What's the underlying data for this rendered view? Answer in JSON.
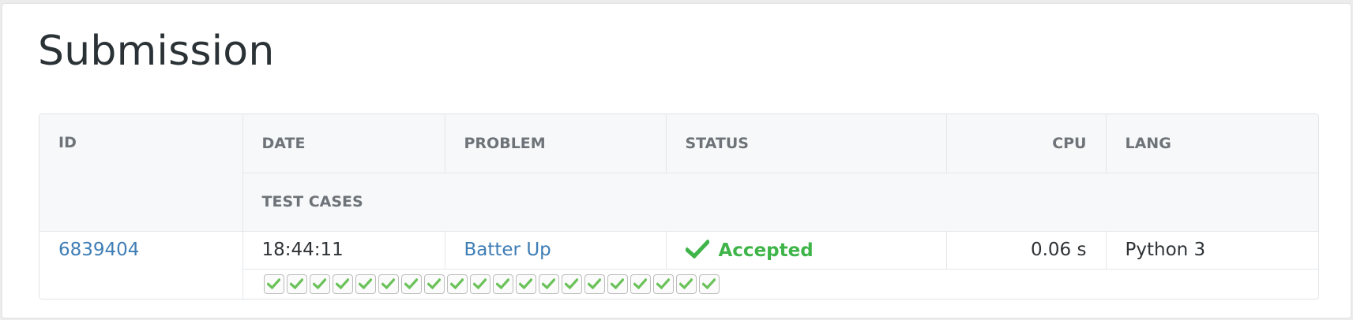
{
  "page": {
    "title": "Submission"
  },
  "table": {
    "headers": {
      "id": "ID",
      "date": "DATE",
      "problem": "PROBLEM",
      "status": "STATUS",
      "cpu": "CPU",
      "lang": "LANG",
      "test_cases": "TEST CASES"
    },
    "row": {
      "id": "6839404",
      "date": "18:44:11",
      "problem": "Batter Up",
      "status": "Accepted",
      "status_icon": "check-icon",
      "cpu": "0.06 s",
      "lang": "Python 3",
      "test_cases": [
        "passed",
        "passed",
        "passed",
        "passed",
        "passed",
        "passed",
        "passed",
        "passed",
        "passed",
        "passed",
        "passed",
        "passed",
        "passed",
        "passed",
        "passed",
        "passed",
        "passed",
        "passed",
        "passed",
        "passed"
      ]
    }
  },
  "colors": {
    "accepted": "#3fb449",
    "link": "#3e7db5",
    "test_case_pass": "#6ac259"
  }
}
